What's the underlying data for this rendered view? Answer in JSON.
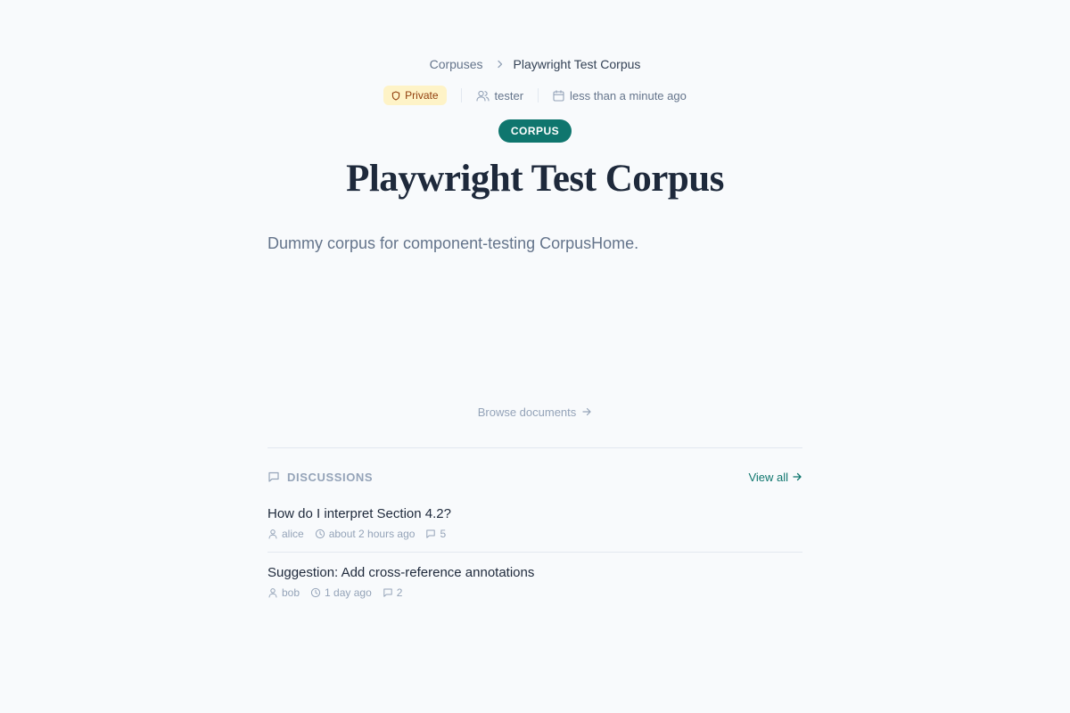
{
  "breadcrumb": {
    "parent": "Corpuses",
    "current": "Playwright Test Corpus"
  },
  "meta": {
    "visibility": "Private",
    "owner": "tester",
    "created": "less than a minute ago"
  },
  "type_badge": "CORPUS",
  "title": "Playwright Test Corpus",
  "description": "Dummy corpus for component-testing CorpusHome.",
  "browse_label": "Browse documents",
  "discussions": {
    "heading": "DISCUSSIONS",
    "view_all": "View all",
    "threads": [
      {
        "title": "How do I interpret Section 4.2?",
        "author": "alice",
        "time": "about 2 hours ago",
        "replies": "5"
      },
      {
        "title": "Suggestion: Add cross-reference annotations",
        "author": "bob",
        "time": "1 day ago",
        "replies": "2"
      }
    ]
  },
  "colors": {
    "accent": "#0f766e",
    "private_bg": "#fef3c7",
    "private_text": "#92400e",
    "page_bg": "#f8fafc"
  }
}
